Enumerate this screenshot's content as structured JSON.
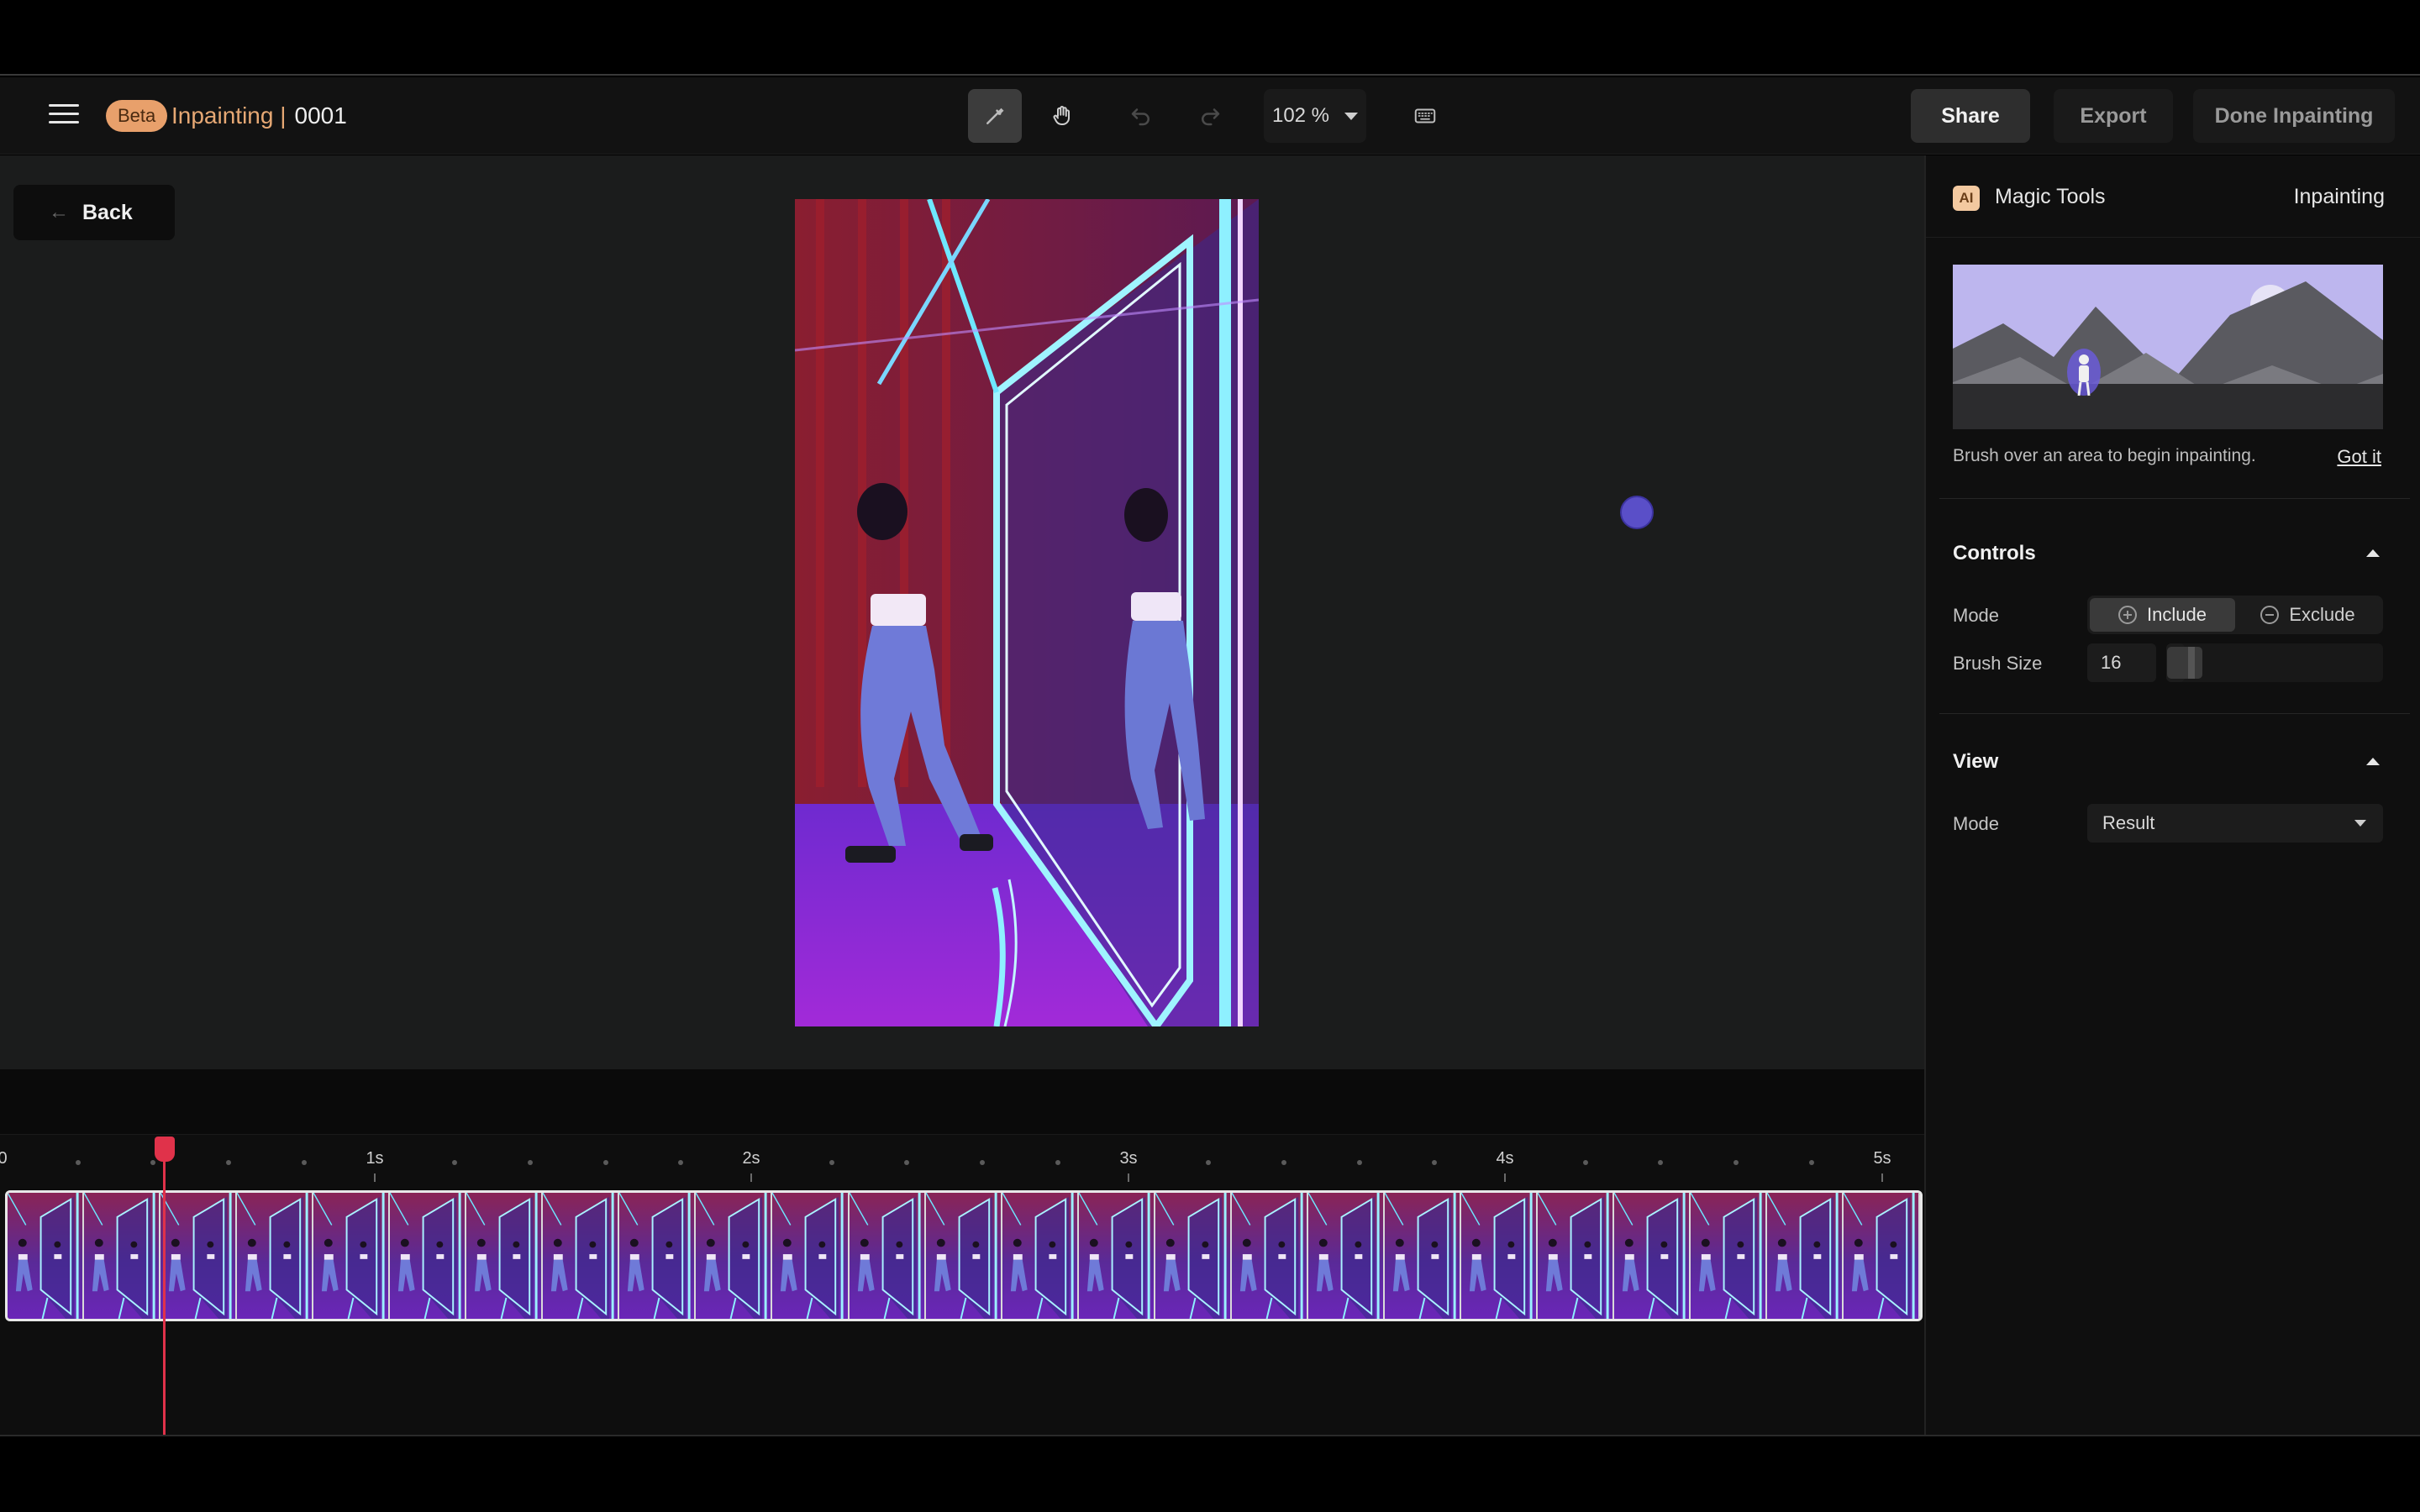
{
  "header": {
    "beta_label": "Beta",
    "app_title": "Inpainting |",
    "project_number": "0001",
    "zoom_value": "102 %",
    "share_label": "Share",
    "export_label": "Export",
    "done_label": "Done Inpainting"
  },
  "toolbar": {
    "tools": [
      "brush-icon",
      "hand-icon",
      "undo-icon",
      "redo-icon",
      "keyboard-icon"
    ],
    "active_tool": "brush-icon"
  },
  "canvas": {
    "back_label": "Back",
    "back_icon": "arrow-left-icon"
  },
  "timeline": {
    "ticks": [
      "0",
      "1s",
      "2s",
      "3s",
      "4s",
      "5s"
    ],
    "playhead_color": "#e0324a"
  },
  "panel": {
    "ai_badge": "AI",
    "title": "Magic Tools",
    "tool_name": "Inpainting",
    "hint": "Brush over an area to begin inpainting.",
    "got_it": "Got it",
    "controls": {
      "title": "Controls",
      "mode_label": "Mode",
      "include_label": "Include",
      "exclude_label": "Exclude",
      "active_mode": "Include",
      "brush_size_label": "Brush Size",
      "brush_size_value": "16"
    },
    "view": {
      "title": "View",
      "mode_label": "Mode",
      "mode_value": "Result"
    }
  },
  "colors": {
    "accent_orange": "#e8a06b",
    "background": "#121212",
    "brush_cursor": "#5a4fc8"
  }
}
